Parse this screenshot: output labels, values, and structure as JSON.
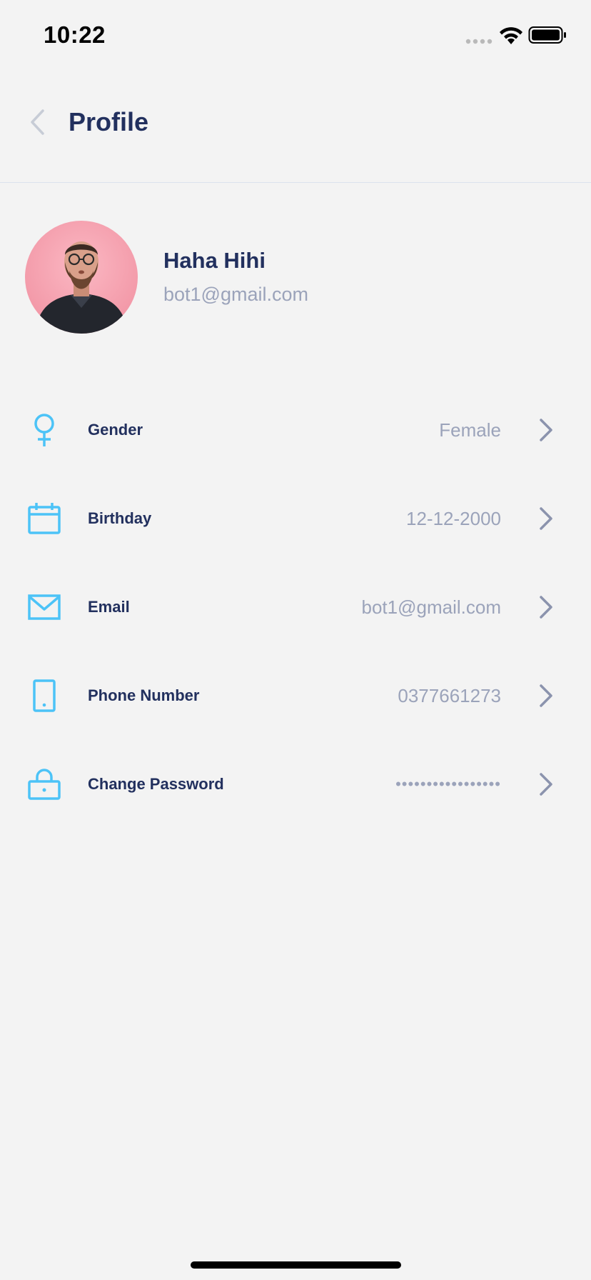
{
  "status_bar": {
    "time": "10:22"
  },
  "header": {
    "title": "Profile"
  },
  "profile": {
    "name": "Haha Hihi",
    "email": "bot1@gmail.com"
  },
  "settings": [
    {
      "icon": "female-icon",
      "label": "Gender",
      "value": "Female"
    },
    {
      "icon": "calendar-icon",
      "label": "Birthday",
      "value": "12-12-2000"
    },
    {
      "icon": "mail-icon",
      "label": "Email",
      "value": "bot1@gmail.com"
    },
    {
      "icon": "phone-icon",
      "label": "Phone Number",
      "value": "0377661273"
    },
    {
      "icon": "lock-icon",
      "label": "Change Password",
      "value": "•••••••••••••••••"
    }
  ],
  "colors": {
    "background": "#f3f3f3",
    "title": "#22305e",
    "secondary_text": "#9ba3ba",
    "icon_accent": "#4cc3f7",
    "chevron": "#8b93ad",
    "avatar_bg": "#f39aa9"
  }
}
